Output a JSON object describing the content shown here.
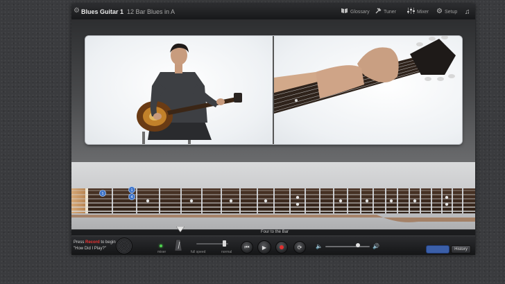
{
  "window": {
    "app_title": "Blues Guitar 1",
    "lesson_title": "12 Bar Blues in A"
  },
  "toolbar": {
    "glossary_label": "Glossary",
    "tuner_label": "Tuner",
    "mixer_label": "Mixer",
    "setup_label": "Setup",
    "icons": [
      "gear-icon",
      "book-icon",
      "tuning-fork-icon",
      "mixer-icon",
      "music-note-icon"
    ]
  },
  "fretboard": {
    "finger_dots": [
      "1",
      "1",
      "4"
    ]
  },
  "lesson": {
    "section_label": "Four to the Bar"
  },
  "controls": {
    "hint_line1_prefix": "Press",
    "hint_record_word": "Record",
    "hint_line1_suffix": "to begin",
    "hint_line2": "\"How Did I Play?\"",
    "mode_label": "mixer",
    "full_speed_label": "full speed",
    "normal_label": "normal",
    "history_label": "History",
    "colors": {
      "record": "#e03030",
      "mode_led": "#4fd24f",
      "active_pill": "#3b5fa8"
    }
  }
}
